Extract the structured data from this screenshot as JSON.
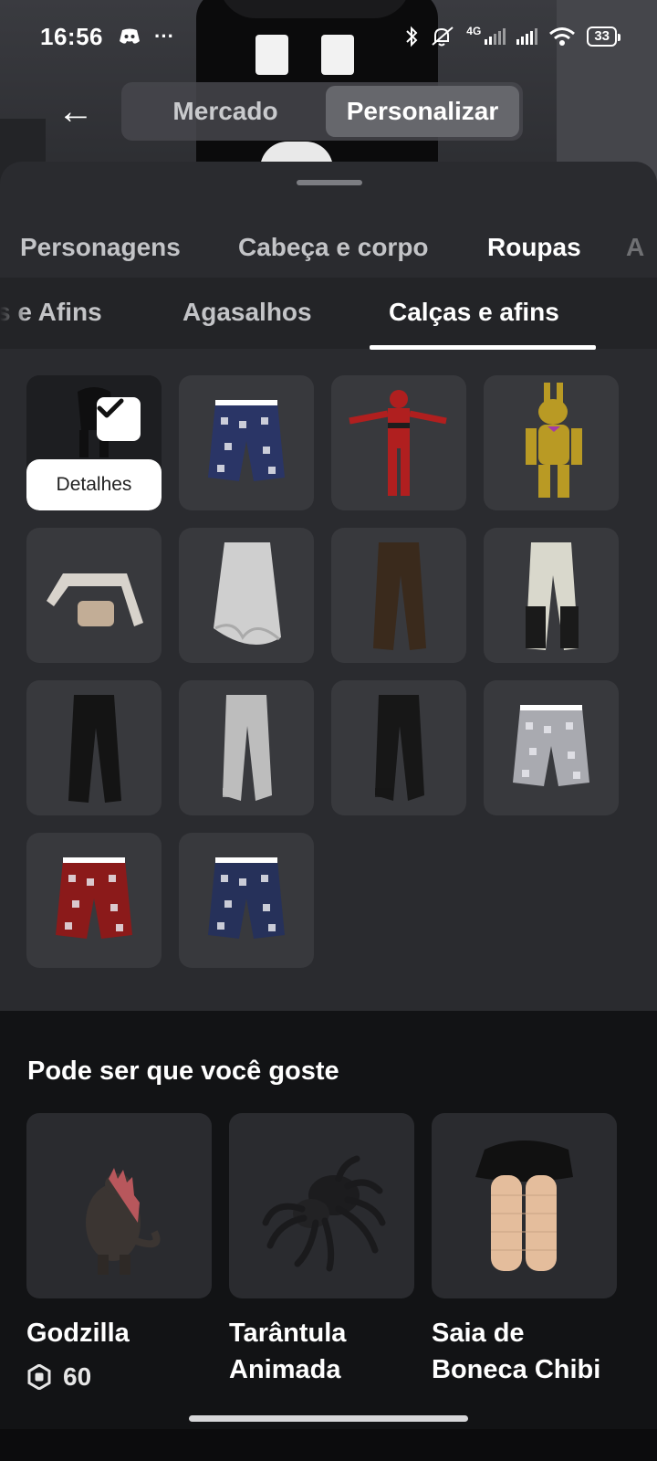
{
  "status_bar": {
    "time": "16:56",
    "battery": "33",
    "network": "4G",
    "icons": [
      "discord-icon",
      "more-dots-icon",
      "bluetooth-icon",
      "mute-icon",
      "signal-icon",
      "signal-icon",
      "wifi-icon",
      "battery-icon"
    ],
    "more": "···"
  },
  "header": {
    "back_icon": "←",
    "segments": [
      "Mercado",
      "Personalizar"
    ],
    "active_segment": "Personalizar"
  },
  "categories": {
    "tabs": [
      "Personagens",
      "Cabeça e corpo",
      "Roupas",
      "A"
    ],
    "active": "Roupas"
  },
  "subcategories": {
    "tabs": [
      "s e Afins",
      "Agasalhos",
      "Calças e afins"
    ],
    "active": "Calças e afins"
  },
  "grid": {
    "details_label": "Detalhes",
    "items": [
      {
        "kind": "equipped-skirt",
        "selected": true
      },
      {
        "kind": "shorts",
        "color": "#2a3566"
      },
      {
        "kind": "deadpool-suit",
        "color": "#b01f1f"
      },
      {
        "kind": "springtrap-suit",
        "color": "#b99a24"
      },
      {
        "kind": "crop-top-outfit",
        "color": "#d8d3cc"
      },
      {
        "kind": "ruffle-skirt",
        "color": "#cfcfcf"
      },
      {
        "kind": "pants",
        "color": "#3a2a1c"
      },
      {
        "kind": "moto-pants",
        "color": "#d9d8cc"
      },
      {
        "kind": "pants",
        "color": "#141414"
      },
      {
        "kind": "joggers",
        "color": "#bdbdbd"
      },
      {
        "kind": "joggers",
        "color": "#171717"
      },
      {
        "kind": "shorts",
        "color": "#a9aab0"
      },
      {
        "kind": "shorts",
        "color": "#8b1a1a"
      },
      {
        "kind": "shorts",
        "color": "#26315a"
      }
    ]
  },
  "recommendations": {
    "title": "Pode ser que você goste",
    "items": [
      {
        "name": "Godzilla",
        "price": "60"
      },
      {
        "name": "Tarântula Animada",
        "price": ""
      },
      {
        "name": "Saia de Boneca Chibi",
        "price": ""
      }
    ]
  }
}
